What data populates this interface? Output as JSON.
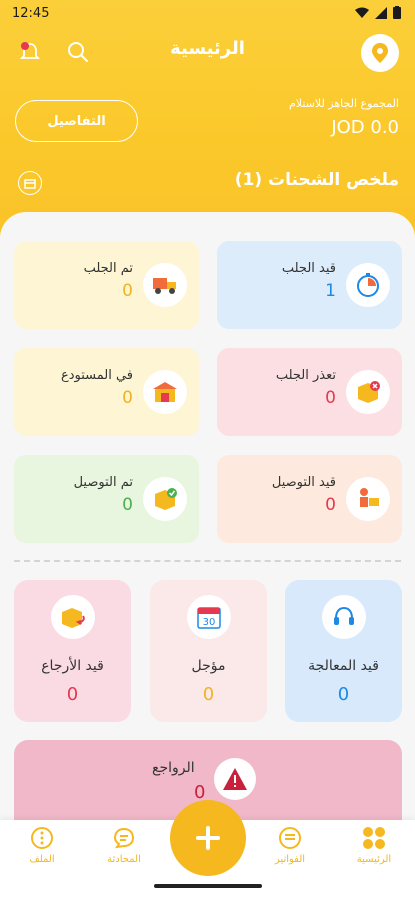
{
  "status_bar": {
    "time": "12:45"
  },
  "header": {
    "title": "الرئيسية",
    "details_button": "التفاصيل",
    "total_label": "المجموع الجاهز للاستلام",
    "total_value": "JOD 0.0",
    "summary_title": "ملخص الشحنات (1)"
  },
  "cards": {
    "pickup_pending": {
      "label": "قيد الجلب",
      "value": "1",
      "color": "#dcecfb"
    },
    "picked_up": {
      "label": "تم الجلب",
      "value": "0",
      "color": "#fdf5d3"
    },
    "pickup_failed": {
      "label": "تعذر الجلب",
      "value": "0",
      "color": "#fbdfe3"
    },
    "in_warehouse": {
      "label": "في المستودع",
      "value": "0",
      "color": "#fdf5d3"
    },
    "delivering": {
      "label": "قيد التوصيل",
      "value": "0",
      "color": "#fde9dd"
    },
    "delivered": {
      "label": "تم التوصيل",
      "value": "0",
      "color": "#e8f5df"
    },
    "processing": {
      "label": "قيد المعالجة",
      "value": "0",
      "color": "#d7e9fb"
    },
    "postponed": {
      "label": "مؤجل",
      "value": "0",
      "color": "#fbe9e9"
    },
    "returning": {
      "label": "قيد الأرجاع",
      "value": "0",
      "color": "#fbdbe3"
    },
    "returns": {
      "label": "الرواجع",
      "value": "0"
    }
  },
  "calendar_day": "30",
  "bottom_nav": {
    "home": "الرئيسية",
    "invoices": "الفواتير",
    "chat": "المحادثة",
    "profile": "الملف"
  },
  "colors": {
    "accent": "#f6b81f",
    "pending_value": "#1e88e5",
    "warning_value": "#f0b323",
    "danger_value": "#e53950",
    "success_value": "#4caf50",
    "processing_value": "#1e88e5"
  }
}
